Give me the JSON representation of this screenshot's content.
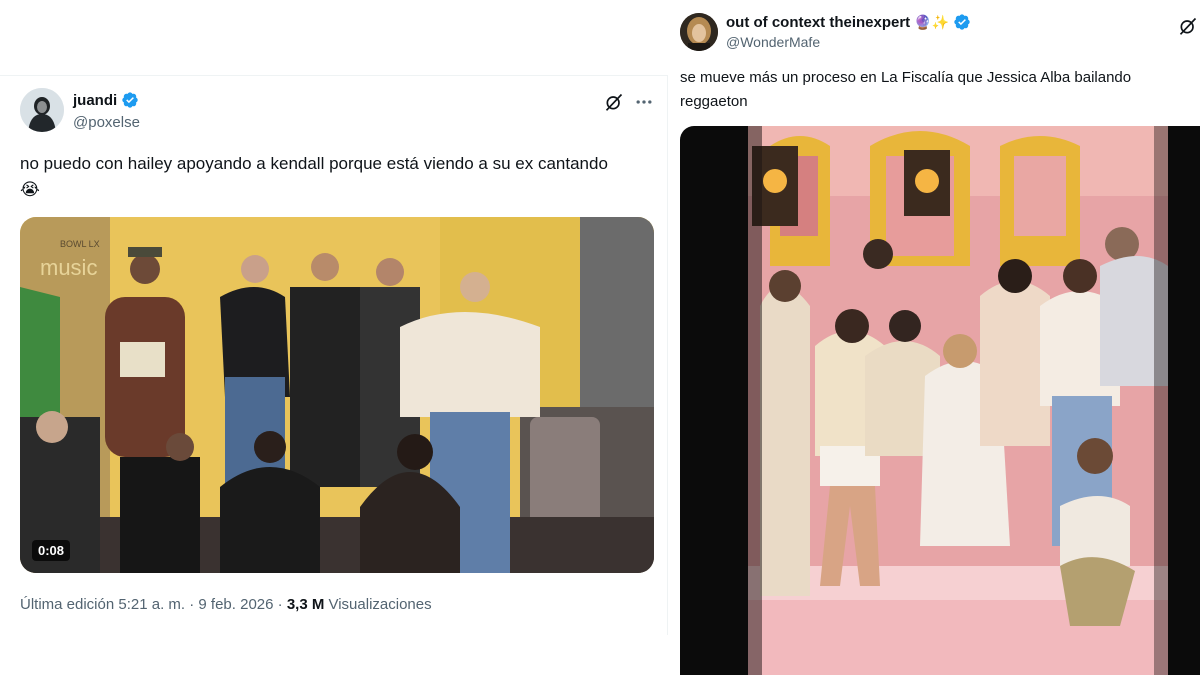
{
  "tweets": [
    {
      "display_name": "juandi",
      "handle": "@poxelse",
      "verified": true,
      "text": "no puedo con hailey apoyando a kendall porque está viendo a su ex cantando 😭",
      "video_duration": "0:08",
      "meta": {
        "edited_label": "Última edición 5:21 a. m. · 9 feb. 2026 · ",
        "views_count": "3,3 M",
        "views_label": " Visualizaciones"
      },
      "media_sign_text": "music",
      "media_sign_small": "BOWL LX"
    },
    {
      "display_name": "out of context theinexpert",
      "name_emojis": "🔮✨",
      "handle": "@WonderMafe",
      "verified": true,
      "text": "se mueve más un proceso en La Fiscalía que Jessica Alba bailando reggaeton"
    }
  ],
  "colors": {
    "verified_blue": "#1d9bf0",
    "text_primary": "#0f1419",
    "text_secondary": "#536471"
  },
  "icons": [
    "grok-icon",
    "more-icon",
    "verified-badge-icon"
  ]
}
